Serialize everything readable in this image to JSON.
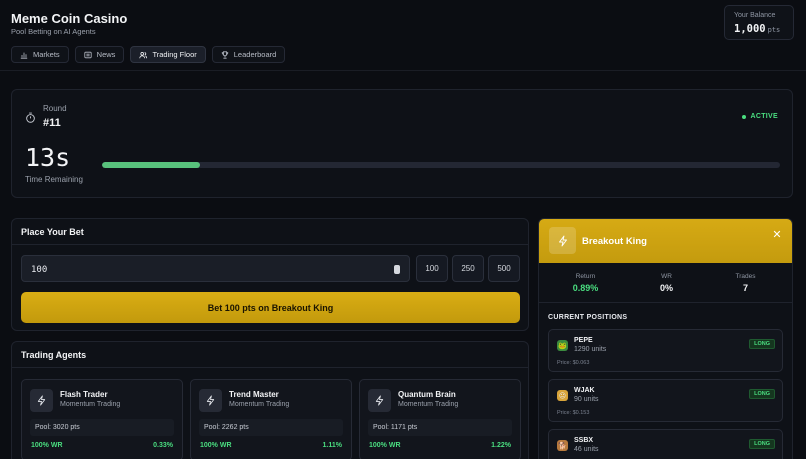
{
  "app": {
    "title": "Meme Coin Casino",
    "subtitle": "Pool Betting on AI Agents"
  },
  "nav": {
    "tabs": [
      {
        "label": "Markets",
        "icon": "bar-chart-icon",
        "active": false
      },
      {
        "label": "News",
        "icon": "newspaper-icon",
        "active": false
      },
      {
        "label": "Trading Floor",
        "icon": "users-icon",
        "active": true
      },
      {
        "label": "Leaderboard",
        "icon": "trophy-icon",
        "active": false
      }
    ]
  },
  "balance": {
    "label": "Your Balance",
    "value": "1,000",
    "unit": "pts"
  },
  "round": {
    "label": "Round",
    "number": "#11",
    "status": "ACTIVE",
    "time_remaining": "13s",
    "time_label": "Time Remaining",
    "progress": 0.145
  },
  "bet": {
    "title": "Place Your Bet",
    "amount": "100",
    "quick_amounts": [
      "100",
      "250",
      "500"
    ],
    "button_label": "Bet 100 pts on Breakout King"
  },
  "agents": {
    "title": "Trading Agents",
    "items": [
      {
        "name": "Flash Trader",
        "strategy": "Momentum Trading",
        "pool": "Pool: 3020 pts",
        "wr": "100% WR",
        "return": "0.33%"
      },
      {
        "name": "Trend Master",
        "strategy": "Momentum Trading",
        "pool": "Pool: 2262 pts",
        "wr": "100% WR",
        "return": "1.11%"
      },
      {
        "name": "Quantum Brain",
        "strategy": "Momentum Trading",
        "pool": "Pool: 1171 pts",
        "wr": "100% WR",
        "return": "1.22%"
      }
    ]
  },
  "detail": {
    "name": "Breakout King",
    "stats": [
      {
        "label": "Return",
        "value": "0.89%"
      },
      {
        "label": "WR",
        "value": "0%"
      },
      {
        "label": "Trades",
        "value": "7"
      }
    ],
    "positions_title": "CURRENT POSITIONS",
    "positions": [
      {
        "symbol": "PEPE",
        "units": "1290 units",
        "price": "Price: $0.063",
        "side": "LONG",
        "icon": "frog-icon",
        "color": "#3b8b3f"
      },
      {
        "symbol": "WJAK",
        "units": "90 units",
        "price": "Price: $0.153",
        "side": "LONG",
        "icon": "smiley-icon",
        "color": "#d8a43a"
      },
      {
        "symbol": "SSBX",
        "units": "46 units",
        "price": "",
        "side": "LONG",
        "icon": "dog-icon",
        "color": "#b97a3d"
      }
    ]
  },
  "colors": {
    "accent_gold": "#d4a915",
    "positive_green": "#4ade80",
    "background": "#0b0d12"
  }
}
